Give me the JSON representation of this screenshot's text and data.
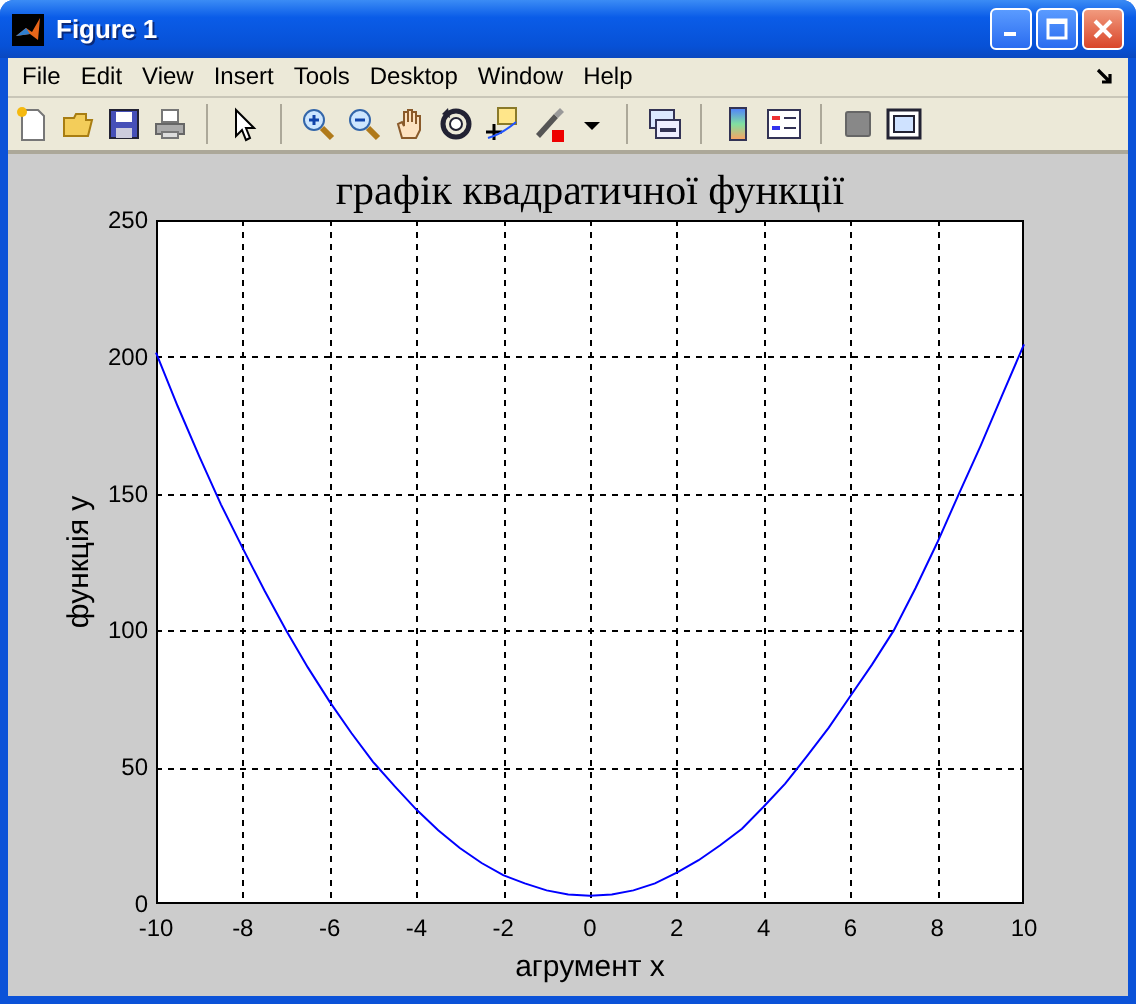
{
  "window": {
    "title": "Figure 1"
  },
  "menu": [
    "File",
    "Edit",
    "View",
    "Insert",
    "Tools",
    "Desktop",
    "Window",
    "Help"
  ],
  "figure": {
    "chart_data": {
      "type": "line",
      "title": "графік квадратичної функції",
      "xlabel": "агрумент x",
      "ylabel": "функція y",
      "x": [
        -10,
        -9.5,
        -9,
        -8.5,
        -8,
        -7.5,
        -7,
        -6.5,
        -6,
        -5.5,
        -5,
        -4.5,
        -4,
        -3.5,
        -3,
        -2.5,
        -2,
        -1.5,
        -1,
        -0.5,
        0,
        0.5,
        1,
        1.5,
        2,
        2.5,
        3,
        3.5,
        4,
        4.5,
        5,
        5.5,
        6,
        6.5,
        7,
        7.5,
        8,
        8.5,
        9,
        9.5,
        10
      ],
      "series": [
        {
          "color": "#0000ff",
          "values": [
            201.5,
            182,
            163.5,
            146,
            130,
            114.5,
            100,
            86.5,
            74,
            62.5,
            52,
            43,
            34.5,
            27,
            20.5,
            15,
            10.5,
            7.5,
            5,
            3.5,
            3,
            3.5,
            5,
            7.5,
            11.5,
            16,
            21.5,
            27.5,
            35.5,
            44,
            54,
            64.5,
            76,
            87.5,
            100,
            115.5,
            132,
            150,
            167.5,
            186,
            204.5
          ]
        }
      ],
      "grid": true,
      "xlim": [
        -10,
        10
      ],
      "ylim": [
        0,
        250
      ],
      "xticks": [
        -10,
        -8,
        -6,
        -4,
        -2,
        0,
        2,
        4,
        6,
        8,
        10
      ],
      "yticks": [
        0,
        50,
        100,
        150,
        200,
        250
      ]
    }
  }
}
